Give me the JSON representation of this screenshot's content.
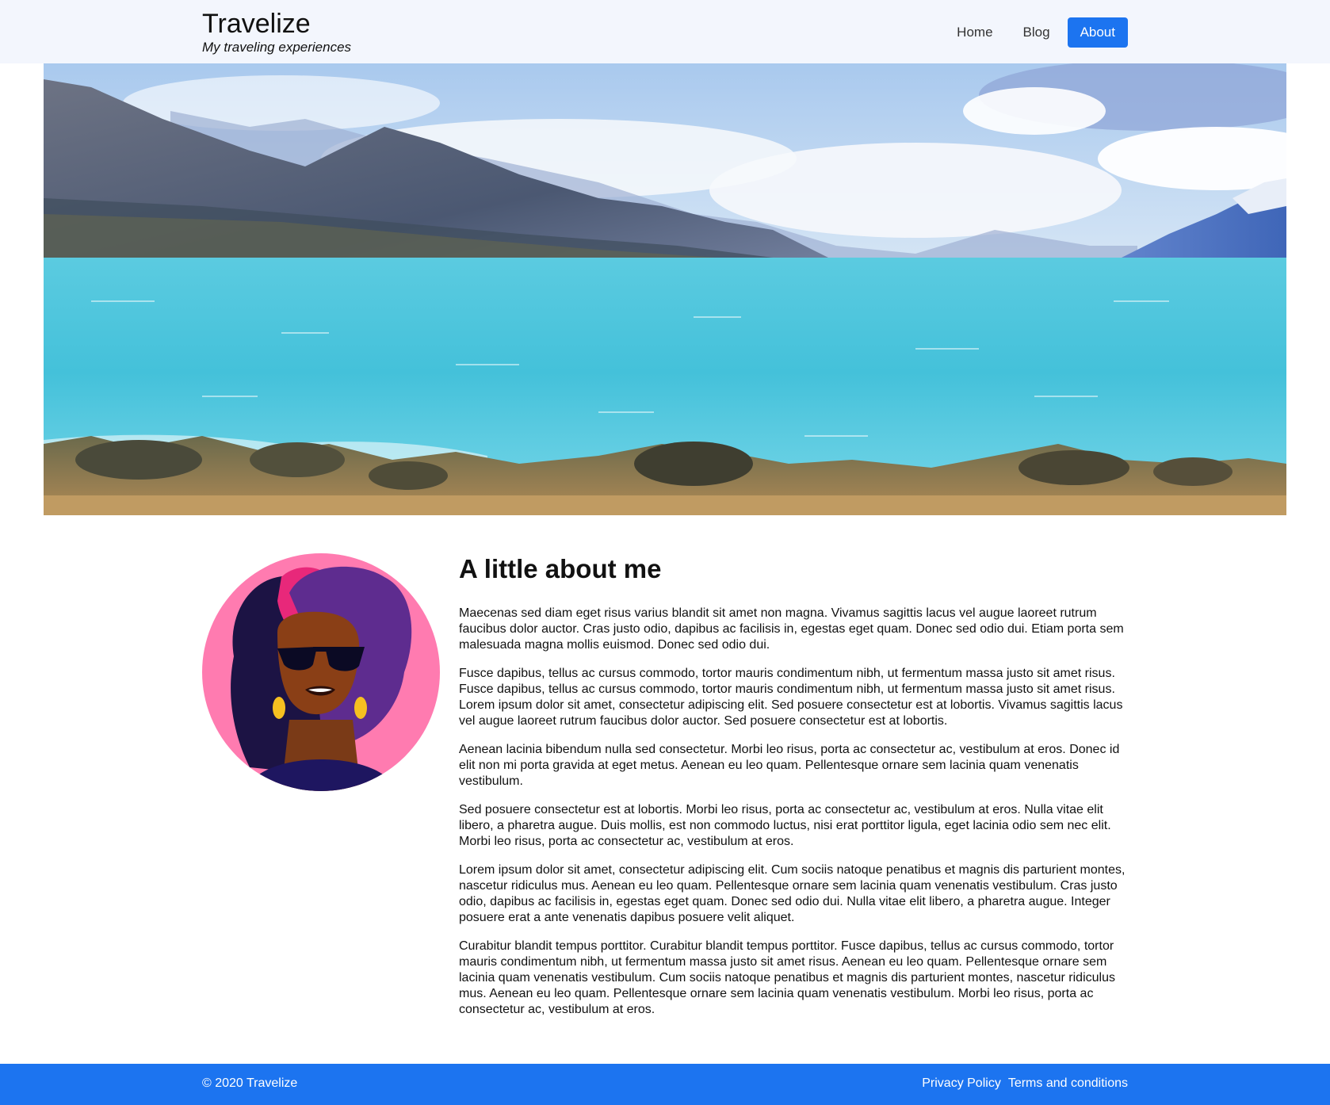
{
  "header": {
    "title": "Travelize",
    "subtitle": "My traveling experiences",
    "nav": [
      {
        "label": "Home",
        "active": false
      },
      {
        "label": "Blog",
        "active": false
      },
      {
        "label": "About",
        "active": true
      }
    ]
  },
  "hero": {
    "image": "lake-mountains-landscape"
  },
  "about": {
    "heading": "A little about me",
    "avatar": "woman-with-sunglasses-illustration",
    "paragraphs": [
      "Maecenas sed diam eget risus varius blandit sit amet non magna. Vivamus sagittis lacus vel augue laoreet rutrum faucibus dolor auctor. Cras justo odio, dapibus ac facilisis in, egestas eget quam. Donec sed odio dui. Etiam porta sem malesuada magna mollis euismod. Donec sed odio dui.",
      "Fusce dapibus, tellus ac cursus commodo, tortor mauris condimentum nibh, ut fermentum massa justo sit amet risus. Fusce dapibus, tellus ac cursus commodo, tortor mauris condimentum nibh, ut fermentum massa justo sit amet risus. Lorem ipsum dolor sit amet, consectetur adipiscing elit. Sed posuere consectetur est at lobortis. Vivamus sagittis lacus vel augue laoreet rutrum faucibus dolor auctor. Sed posuere consectetur est at lobortis.",
      "Aenean lacinia bibendum nulla sed consectetur. Morbi leo risus, porta ac consectetur ac, vestibulum at eros. Donec id elit non mi porta gravida at eget metus. Aenean eu leo quam. Pellentesque ornare sem lacinia quam venenatis vestibulum.",
      "Sed posuere consectetur est at lobortis. Morbi leo risus, porta ac consectetur ac, vestibulum at eros. Nulla vitae elit libero, a pharetra augue. Duis mollis, est non commodo luctus, nisi erat porttitor ligula, eget lacinia odio sem nec elit. Morbi leo risus, porta ac consectetur ac, vestibulum at eros.",
      "Lorem ipsum dolor sit amet, consectetur adipiscing elit. Cum sociis natoque penatibus et magnis dis parturient montes, nascetur ridiculus mus. Aenean eu leo quam. Pellentesque ornare sem lacinia quam venenatis vestibulum. Cras justo odio, dapibus ac facilisis in, egestas eget quam. Donec sed odio dui. Nulla vitae elit libero, a pharetra augue. Integer posuere erat a ante venenatis dapibus posuere velit aliquet.",
      "Curabitur blandit tempus porttitor. Curabitur blandit tempus porttitor. Fusce dapibus, tellus ac cursus commodo, tortor mauris condimentum nibh, ut fermentum massa justo sit amet risus. Aenean eu leo quam. Pellentesque ornare sem lacinia quam venenatis vestibulum. Cum sociis natoque penatibus et magnis dis parturient montes, nascetur ridiculus mus. Aenean eu leo quam. Pellentesque ornare sem lacinia quam venenatis vestibulum. Morbi leo risus, porta ac consectetur ac, vestibulum at eros."
    ]
  },
  "footer": {
    "copyright": "© 2020 Travelize",
    "links": [
      "Privacy Policy",
      "Terms and conditions"
    ]
  },
  "colors": {
    "accent": "#1c74f0",
    "topbar_bg": "#f3f6fd"
  }
}
